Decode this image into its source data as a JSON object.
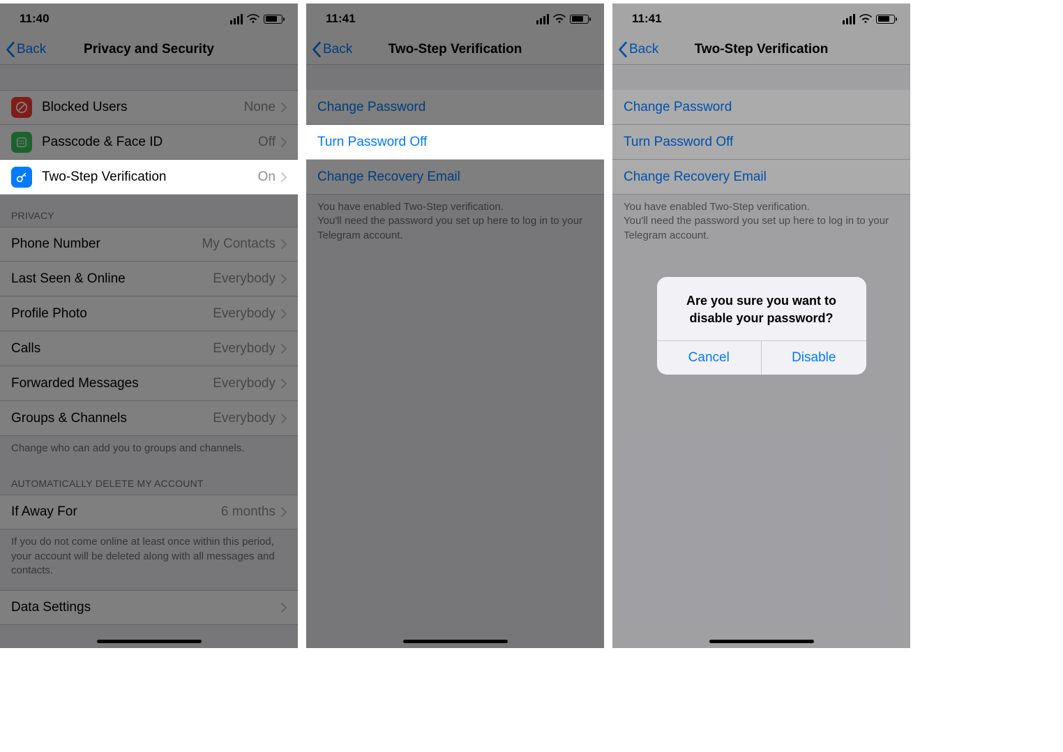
{
  "screen1": {
    "time": "11:40",
    "back": "Back",
    "title": "Privacy and Security",
    "rows1": [
      {
        "label": "Blocked Users",
        "value": "None",
        "icon": "blocked"
      },
      {
        "label": "Passcode & Face ID",
        "value": "Off",
        "icon": "passcode"
      },
      {
        "label": "Two-Step Verification",
        "value": "On",
        "icon": "2sv",
        "highlight": true
      }
    ],
    "privacy_header": "PRIVACY",
    "rows2": [
      {
        "label": "Phone Number",
        "value": "My Contacts"
      },
      {
        "label": "Last Seen & Online",
        "value": "Everybody"
      },
      {
        "label": "Profile Photo",
        "value": "Everybody"
      },
      {
        "label": "Calls",
        "value": "Everybody"
      },
      {
        "label": "Forwarded Messages",
        "value": "Everybody"
      },
      {
        "label": "Groups & Channels",
        "value": "Everybody"
      }
    ],
    "privacy_footer": "Change who can add you to groups and channels.",
    "auto_header": "AUTOMATICALLY DELETE MY ACCOUNT",
    "rows3": [
      {
        "label": "If Away For",
        "value": "6 months"
      }
    ],
    "auto_footer": "If you do not come online at least once within this period, your account will be deleted along with all messages and contacts.",
    "rows4": [
      {
        "label": "Data Settings"
      }
    ]
  },
  "screen2": {
    "time": "11:41",
    "back": "Back",
    "title": "Two-Step Verification",
    "links": [
      {
        "label": "Change Password"
      },
      {
        "label": "Turn Password Off",
        "highlight": true
      },
      {
        "label": "Change Recovery Email"
      }
    ],
    "footer": "You have enabled Two-Step verification.\nYou'll need the password you set up here to log in to your Telegram account."
  },
  "screen3": {
    "time": "11:41",
    "back": "Back",
    "title": "Two-Step Verification",
    "links": [
      {
        "label": "Change Password"
      },
      {
        "label": "Turn Password Off"
      },
      {
        "label": "Change Recovery Email"
      }
    ],
    "footer": "You have enabled Two-Step verification.\nYou'll need the password you set up here to log in to your Telegram account.",
    "alert": {
      "message": "Are you sure you want to disable your password?",
      "cancel": "Cancel",
      "confirm": "Disable"
    }
  }
}
